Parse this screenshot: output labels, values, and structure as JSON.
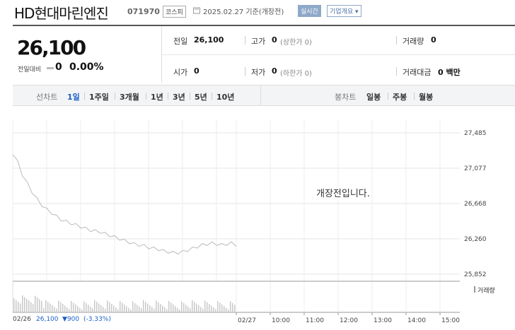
{
  "header": {
    "title": "HD현대마린엔진",
    "code": "071970",
    "market": "코스피",
    "date_text": "2025.02.27 기준(개장전)",
    "realtime_label": "실시간",
    "company_label": "기업개요 ▾"
  },
  "summary": {
    "price": "26,100",
    "change_label": "전일대비",
    "change_value": "0",
    "change_pct": "0.00%",
    "prev_label": "전일",
    "prev_value": "26,100",
    "high_label": "고가",
    "high_value": "0",
    "high_sub": "(상한가 0)",
    "volume_label": "거래량",
    "volume_value": "0",
    "open_label": "시가",
    "open_value": "0",
    "low_label": "저가",
    "low_value": "0",
    "low_sub": "(하한가 0)",
    "amount_label": "거래대금",
    "amount_value": "0 백만"
  },
  "tabs": {
    "line_label": "선차트",
    "periods": [
      "1일",
      "1주일",
      "3개월",
      "1년",
      "3년",
      "5년",
      "10년"
    ],
    "active_period": 0,
    "candle_label": "봉차트",
    "candle_periods": [
      "일봉",
      "주봉",
      "월봉"
    ]
  },
  "chart": {
    "closed_message": "개장전입니다.",
    "volume_legend": "거래량",
    "footer_date": "02/26",
    "footer_price": "26,100",
    "footer_change": "▼900",
    "footer_pct": "(-3.33%)",
    "colors": {
      "line": "#bbbbbb",
      "grid": "#e8e8e8",
      "down": "#1a5fc8"
    }
  },
  "chart_data": {
    "type": "line",
    "y_ticks": [
      "27,485",
      "27,077",
      "26,668",
      "26,260",
      "25,852"
    ],
    "ylim": [
      25852,
      27485
    ],
    "x_ticks": [
      "02/27",
      "10:00",
      "11:00",
      "12:00",
      "13:00",
      "14:00",
      "15:00"
    ],
    "series": [
      {
        "values": [
          27250,
          27150,
          27000,
          26900,
          26800,
          26720,
          26650,
          26600,
          26560,
          26520,
          26480,
          26460,
          26440,
          26420,
          26400,
          26380,
          26360,
          26350,
          26340,
          26320,
          26300,
          26280,
          26260,
          26240,
          26220,
          26200,
          26190,
          26180,
          26160,
          26150,
          26140,
          26120,
          26110,
          26100,
          26100,
          26110,
          26130,
          26150,
          26170,
          26190,
          26200,
          26210,
          26200,
          26190,
          26200,
          26210,
          26190
        ]
      }
    ]
  }
}
